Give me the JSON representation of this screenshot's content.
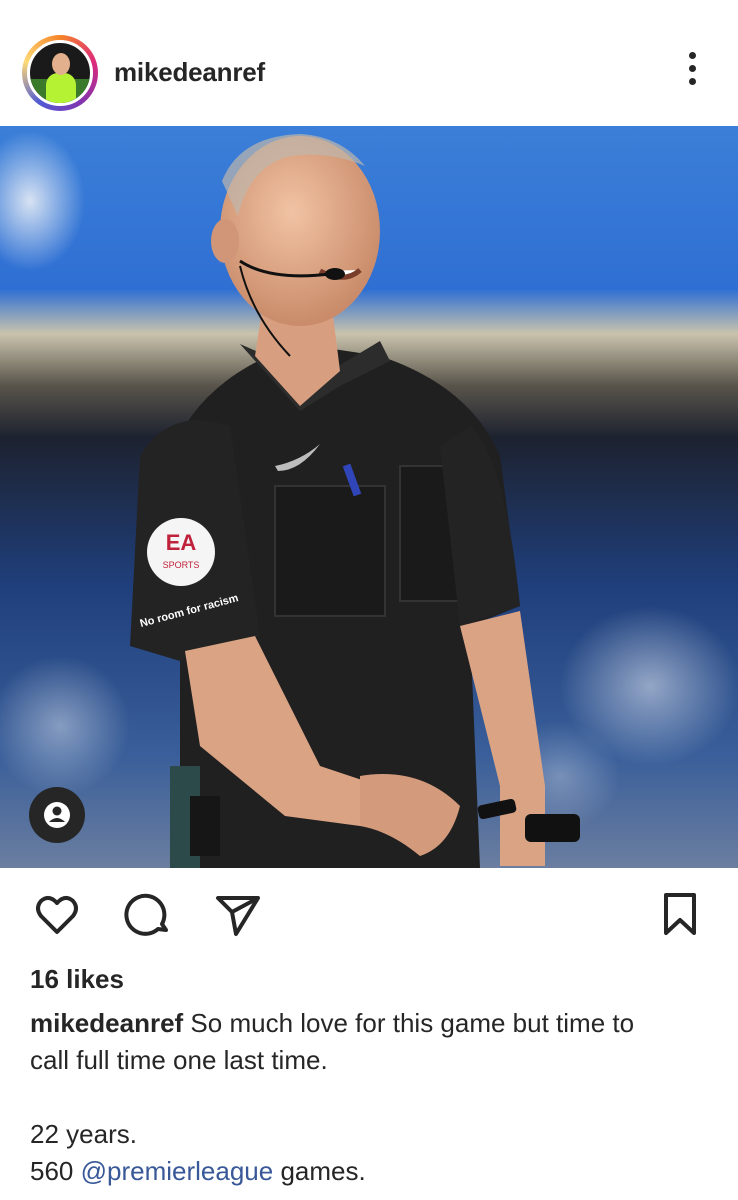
{
  "post": {
    "username": "mikedeanref",
    "likes_label": "16 likes",
    "caption": {
      "username": "mikedeanref",
      "line1": "So much love for this game but time to",
      "line2": "call full time one last time.",
      "line3": "22 years.",
      "line4_prefix": "560",
      "mention": "@premierleague",
      "line4_suffix": "games."
    },
    "photo_badges": {
      "sleeve_badge_top": "EA",
      "sleeve_badge_bottom": "SPORTS",
      "sleeve_patch": "No room for racism"
    }
  },
  "icons": {
    "more": "more-vertical-icon",
    "like": "heart-icon",
    "comment": "comment-icon",
    "share": "send-icon",
    "save": "bookmark-icon",
    "tags": "user-tag-icon"
  },
  "colors": {
    "text": "#262626",
    "mention": "#385898",
    "stadium_blue": "#2f6fd3"
  }
}
